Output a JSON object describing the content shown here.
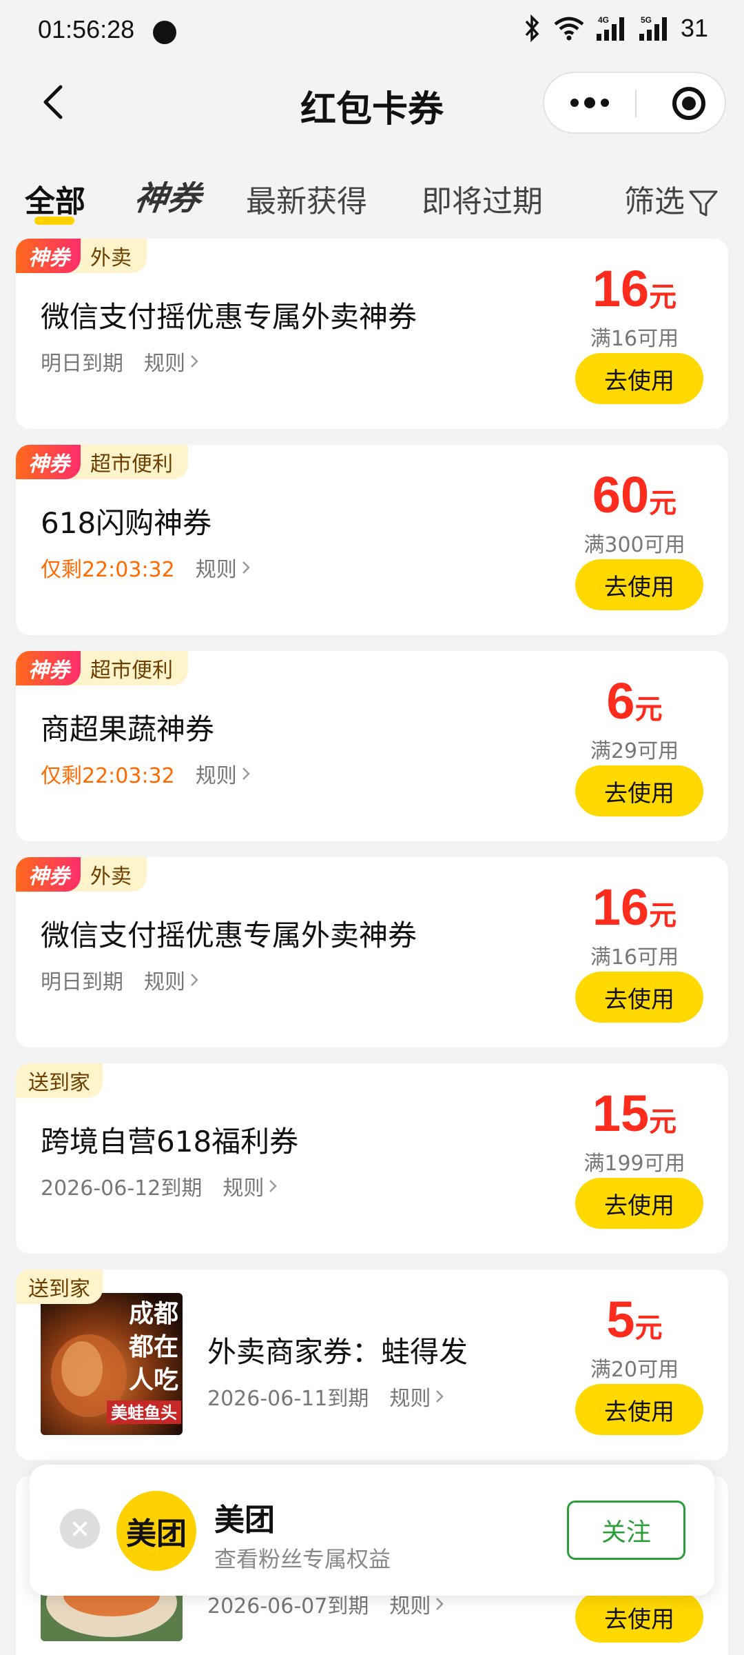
{
  "status": {
    "time": "01:56:28",
    "battery": "31"
  },
  "nav": {
    "title": "红包卡券"
  },
  "tabs": [
    {
      "label": "全部"
    },
    {
      "label": "神券"
    },
    {
      "label": "最新获得"
    },
    {
      "label": "即将过期"
    },
    {
      "label": "筛选"
    }
  ],
  "coupons": [
    {
      "god_tag": "神券",
      "category": "外卖",
      "title": "微信支付摇优惠专属外卖神券",
      "expiry": "明日到期",
      "rule": "规则",
      "amount": "16",
      "unit": "元",
      "condition": "满16可用",
      "button": "去使用"
    },
    {
      "god_tag": "神券",
      "category": "超市便利",
      "title": "618闪购神券",
      "expiry": "仅剩22:03:32",
      "rule": "规则",
      "amount": "60",
      "unit": "元",
      "condition": "满300可用",
      "button": "去使用"
    },
    {
      "god_tag": "神券",
      "category": "超市便利",
      "title": "商超果蔬神券",
      "expiry": "仅剩22:03:32",
      "rule": "规则",
      "amount": "6",
      "unit": "元",
      "condition": "满29可用",
      "button": "去使用"
    },
    {
      "god_tag": "神券",
      "category": "外卖",
      "title": "微信支付摇优惠专属外卖神券",
      "expiry": "明日到期",
      "rule": "规则",
      "amount": "16",
      "unit": "元",
      "condition": "满16可用",
      "button": "去使用"
    },
    {
      "category": "送到家",
      "title": "跨境自营618福利券",
      "expiry": "2026-06-12到期",
      "rule": "规则",
      "amount": "15",
      "unit": "元",
      "condition": "满199可用",
      "button": "去使用"
    },
    {
      "category": "送到家",
      "title": "外卖商家券：蛙得发",
      "expiry": "2026-06-11到期",
      "rule": "规则",
      "amount": "5",
      "unit": "元",
      "condition": "满20可用",
      "button": "去使用",
      "thumb_text": [
        "成都",
        "都在",
        "人吃",
        "美蛙鱼头"
      ]
    },
    {
      "expiry": "2026-06-07到期",
      "rule": "规则",
      "button": "去使用"
    }
  ],
  "popup": {
    "logo": "美团",
    "name": "美团",
    "desc": "查看粉丝专属权益",
    "follow": "关注"
  }
}
